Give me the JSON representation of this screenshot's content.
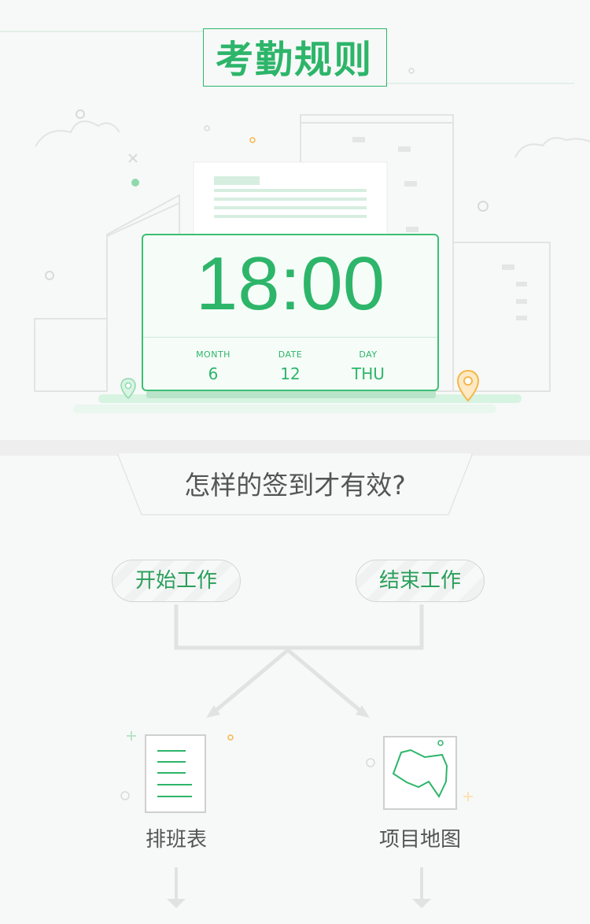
{
  "header": {
    "title": "考勤规则"
  },
  "clock": {
    "time": "18:00",
    "month_label": "MONTH",
    "month_value": "6",
    "date_label": "DATE",
    "date_value": "12",
    "day_label": "DAY",
    "day_value": "THU"
  },
  "question": "怎样的签到才有效?",
  "actions": {
    "start_work": "开始工作",
    "end_work": "结束工作"
  },
  "features": {
    "schedule": "排班表",
    "project_map": "项目地图"
  },
  "colors": {
    "brand_green": "#2db56a",
    "pin_orange": "#f5b74a",
    "pin_green": "#8fd9ac"
  },
  "icons": {
    "location_pin": "map-pin-icon",
    "schedule": "document-lines-icon",
    "map": "map-outline-icon"
  }
}
